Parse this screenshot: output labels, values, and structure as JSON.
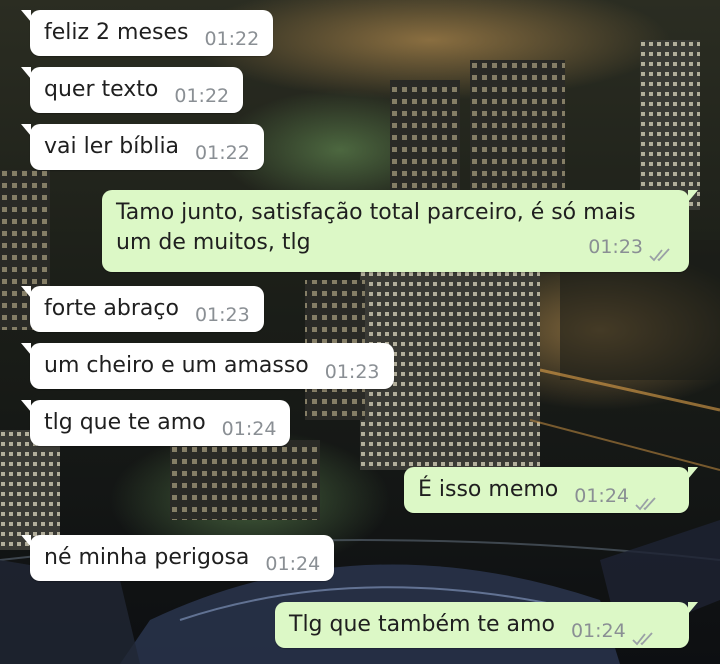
{
  "messages": [
    {
      "text": "feliz 2 meses",
      "time": "01:22",
      "side": "in"
    },
    {
      "text": "quer texto",
      "time": "01:22",
      "side": "in"
    },
    {
      "text": "vai ler bíblia",
      "time": "01:22",
      "side": "in"
    },
    {
      "text_line1": "Tamo junto, satisfação total parceiro, é só mais",
      "text_line2": "um de muitos, tlg",
      "time": "01:23",
      "side": "out",
      "status": "read"
    },
    {
      "text": "forte abraço",
      "time": "01:23",
      "side": "in"
    },
    {
      "text": "um cheiro e um amasso",
      "time": "01:23",
      "side": "in"
    },
    {
      "text": "tlg que te amo",
      "time": "01:24",
      "side": "in"
    },
    {
      "text": "É isso memo",
      "time": "01:24",
      "side": "out",
      "status": "read"
    },
    {
      "text": "né minha perigosa",
      "time": "01:24",
      "side": "in"
    },
    {
      "text": "Tlg que também te amo",
      "time": "01:24",
      "side": "out",
      "status": "read"
    }
  ],
  "icons": {
    "read_receipt": "double-check-icon"
  },
  "colors": {
    "incoming": "#ffffff",
    "outgoing": "#dcf8c6",
    "timestamp": "#8a8f94",
    "ticks": "#9aa0a6"
  }
}
